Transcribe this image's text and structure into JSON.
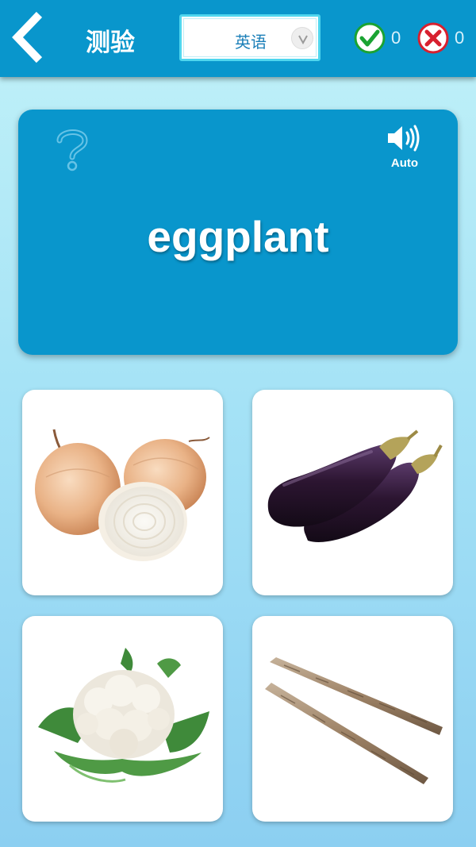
{
  "header": {
    "title": "测验",
    "back_icon": "chevron-left-icon",
    "language": {
      "selected": "英语",
      "icon": "chevron-down-icon"
    },
    "correct_count": "0",
    "wrong_count": "0",
    "correct_icon": "check-circle-icon",
    "wrong_icon": "x-circle-icon"
  },
  "card": {
    "word": "eggplant",
    "hint_icon": "question-mark-icon",
    "audio_icon": "speaker-icon",
    "audio_label": "Auto"
  },
  "options": [
    {
      "image": "onion-image"
    },
    {
      "image": "eggplant-image"
    },
    {
      "image": "cauliflower-image"
    },
    {
      "image": "burdock-root-image"
    }
  ],
  "colors": {
    "header_bg": "#0996cc",
    "card_bg": "#0996cc",
    "correct": "#1aa332",
    "wrong": "#d8202f",
    "select_border": "#4fd6ee"
  }
}
